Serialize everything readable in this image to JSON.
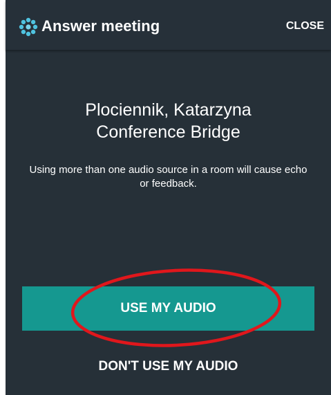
{
  "header": {
    "title": "Answer meeting",
    "close_label": "CLOSE",
    "logo_icon": "starburst-logo-icon"
  },
  "caller": {
    "name": "Plociennik, Katarzyna",
    "type": "Conference Bridge"
  },
  "warning": "Using more than one audio source in a room will cause echo or feedback.",
  "actions": {
    "use_audio_label": "USE MY AUDIO",
    "dont_use_audio_label": "DON'T USE MY AUDIO"
  },
  "colors": {
    "background": "#263038",
    "accent": "#159890",
    "logo": "#4fc3e0",
    "annotation": "#e0171c"
  }
}
